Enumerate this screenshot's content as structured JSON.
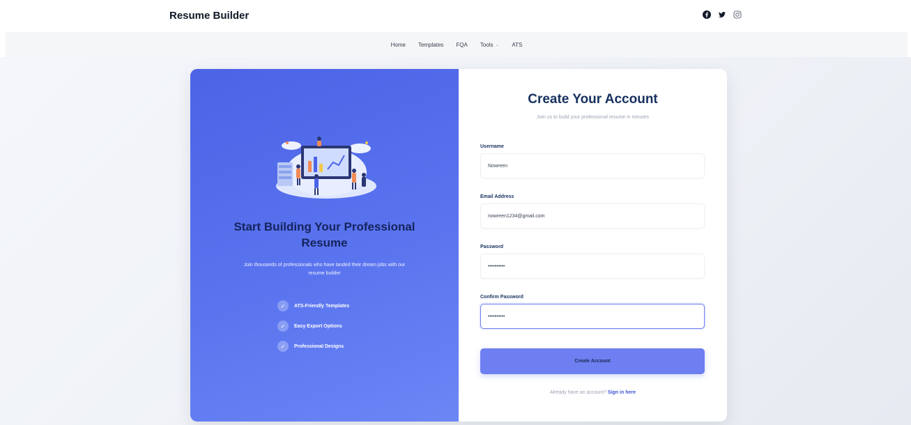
{
  "header": {
    "brand": "Resume Builder",
    "social_icons": [
      "facebook-icon",
      "twitter-icon",
      "instagram-icon"
    ]
  },
  "nav": {
    "items": [
      {
        "label": "Home"
      },
      {
        "label": "Templates"
      },
      {
        "label": "FQA"
      },
      {
        "label": "Tools",
        "dropdown": true
      },
      {
        "label": "ATS"
      }
    ]
  },
  "left_panel": {
    "title": "Start Building Your Professional Resume",
    "subtitle": "Join thousands of professionals who have landed their dream jobs with our resume builder",
    "features": [
      {
        "label": "ATS-Friendly Templates"
      },
      {
        "label": "Easy Export Options"
      },
      {
        "label": "Professional Designs"
      }
    ],
    "colors": {
      "gradient_start": "#4c63e6",
      "gradient_end": "#6b86f5",
      "title": "#15245c"
    }
  },
  "form": {
    "title": "Create Your Account",
    "subtitle": "Join us to build your professional resume in minutes",
    "fields": {
      "username": {
        "label": "Username",
        "value": "Nowreen"
      },
      "email": {
        "label": "Email Address",
        "value": "nowreen1234@gmail.com"
      },
      "password": {
        "label": "Password",
        "value": "••••••••••"
      },
      "confirm_password": {
        "label": "Confirm Password",
        "value": "••••••••••"
      }
    },
    "submit_label": "Create Account",
    "signin_prompt": "Already have an account?",
    "signin_link": "Sign in here",
    "colors": {
      "accent": "#6e7ff1",
      "heading": "#16305f",
      "link": "#3f53d9"
    }
  }
}
